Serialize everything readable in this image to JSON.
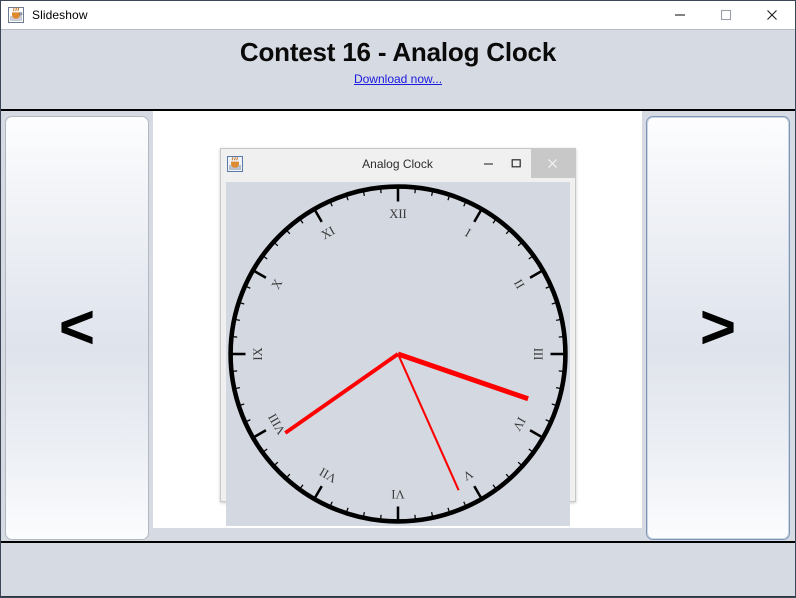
{
  "window": {
    "title": "Slideshow",
    "icon": "java-cup-icon",
    "controls": [
      {
        "name": "minimize-button",
        "glyph": "minimize-icon"
      },
      {
        "name": "maximize-button",
        "glyph": "maximize-icon"
      },
      {
        "name": "close-button",
        "glyph": "close-icon"
      }
    ]
  },
  "header": {
    "title": "Contest 16 - Analog Clock",
    "download_link": "Download now...",
    "link_color": "#1a1ae0"
  },
  "navigation": {
    "prev_label": "<",
    "next_label": ">",
    "prev_name": "previous-slide-button",
    "next_name": "next-slide-button"
  },
  "slide": {
    "inner_window": {
      "title": "Analog Clock",
      "icon": "java-app-icon",
      "minimize_glyph": "–",
      "maximize_glyph": "☐",
      "close_glyph": "×",
      "background": "#d4d8e0"
    }
  },
  "chart_data": {
    "type": "analog-clock",
    "title": "Analog Clock",
    "face": {
      "center": [
        150,
        150
      ],
      "radius": 146,
      "rim_stroke": "#000000",
      "rim_width": 4,
      "background": "#d4d8e0"
    },
    "numerals": [
      {
        "label": "XII",
        "hour": 12,
        "angle_deg": 0
      },
      {
        "label": "I",
        "hour": 1,
        "angle_deg": 30
      },
      {
        "label": "II",
        "hour": 2,
        "angle_deg": 60
      },
      {
        "label": "III",
        "hour": 3,
        "angle_deg": 90
      },
      {
        "label": "IV",
        "hour": 4,
        "angle_deg": 120
      },
      {
        "label": "V",
        "hour": 5,
        "angle_deg": 150
      },
      {
        "label": "VI",
        "hour": 6,
        "angle_deg": 180
      },
      {
        "label": "VII",
        "hour": 7,
        "angle_deg": 210
      },
      {
        "label": "VIII",
        "hour": 8,
        "angle_deg": 240
      },
      {
        "label": "IX",
        "hour": 9,
        "angle_deg": 270
      },
      {
        "label": "X",
        "hour": 10,
        "angle_deg": 300
      },
      {
        "label": "XI",
        "hour": 11,
        "angle_deg": 330
      }
    ],
    "hands": [
      {
        "name": "hour-hand",
        "angle_deg": 109,
        "length": 120,
        "width": 4.4,
        "color": "#ff0000"
      },
      {
        "name": "minute-hand",
        "angle_deg": 235,
        "length": 120,
        "width": 3.4,
        "color": "#ff0000"
      },
      {
        "name": "second-hand",
        "angle_deg": 156,
        "length": 130,
        "width": 1.8,
        "color": "#ff0000"
      }
    ],
    "time_displayed": "3:39:26"
  }
}
